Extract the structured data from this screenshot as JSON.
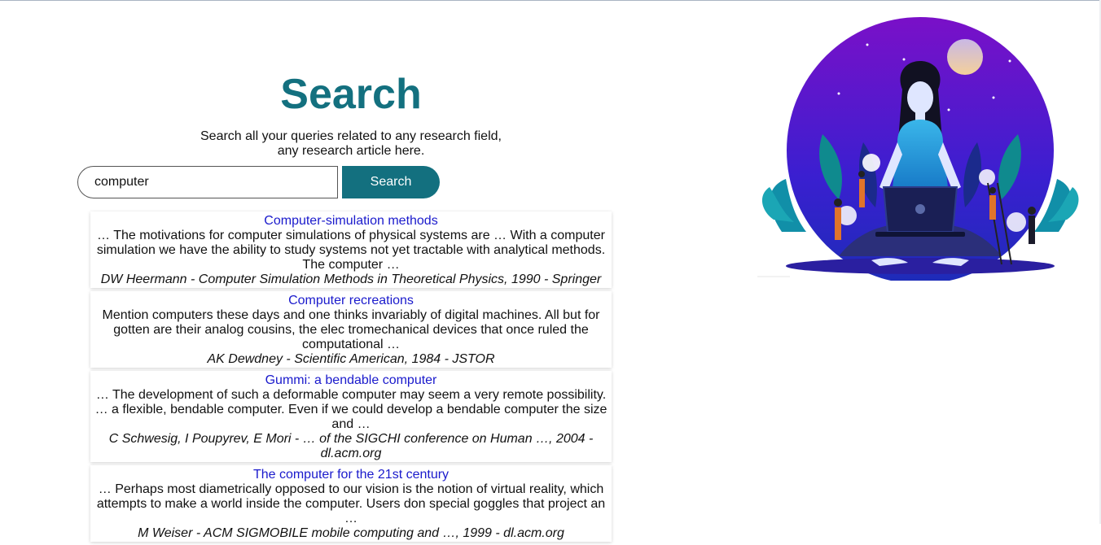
{
  "page": {
    "title": "Search",
    "subtitle_line1": "Search all your queries related to any research field,",
    "subtitle_line2": "any research article here."
  },
  "search": {
    "value": "computer",
    "button_label": "Search"
  },
  "colors": {
    "accent": "#13707f",
    "link": "#1a1acc"
  },
  "results": [
    {
      "title": "Computer-simulation methods",
      "snippet": "… The motivations for computer simulations of physical systems are … With a computer simulation we have the ability to study systems not yet tractable with analytical methods. The computer …",
      "source": "DW Heermann - Computer Simulation Methods in Theoretical Physics, 1990 - Springer"
    },
    {
      "title": "Computer recreations",
      "snippet": "Mention computers these days and one thinks invariably of digital machines. All but for gotten are their analog cousins, the elec tromechanical devices that once ruled the computational …",
      "source": "AK Dewdney - Scientific American, 1984 - JSTOR"
    },
    {
      "title": "Gummi: a bendable computer",
      "snippet": "… The development of such a deformable computer may seem a very remote possibility. … a flexible, bendable computer. Even if we could develop a bendable computer the size and …",
      "source": "C Schwesig, I Poupyrev, E Mori - … of the SIGCHI conference on Human …, 2004 - dl.acm.org"
    },
    {
      "title": "The computer for the 21st century",
      "snippet": "… Perhaps most diametrically opposed to our vision is the notion of virtual reality, which attempts to make a world inside the computer. Users don special goggles that project an …",
      "source": "M Weiser - ACM SIGMOBILE mobile computing and …, 1999 - dl.acm.org"
    }
  ],
  "illustration": {
    "icon": "woman-meditating-with-laptop-illustration"
  }
}
